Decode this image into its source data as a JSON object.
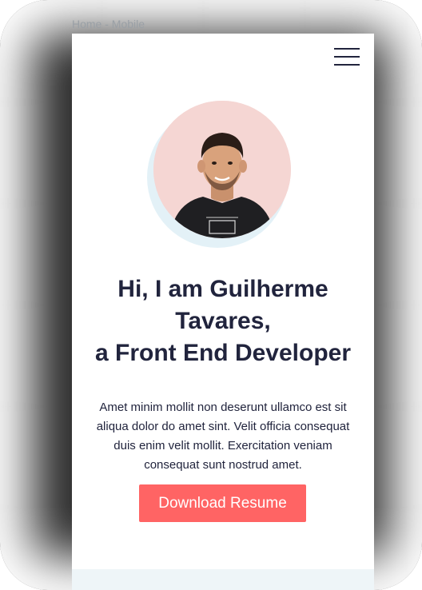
{
  "frame": {
    "title": "Home - Mobile"
  },
  "hero": {
    "headline_line1": "Hi, I am Guilherme",
    "headline_line2": "Tavares,",
    "headline_line3": "a Front End Developer",
    "intro": "Amet minim mollit non deserunt ullamco est sit aliqua dolor do amet sint. Velit officia consequat duis enim velit mollit. Exercitation veniam consequat sunt nostrud amet.",
    "cta_label": "Download Resume"
  },
  "colors": {
    "accent": "#ff6464",
    "text": "#21243d",
    "avatar_ring": "#e3f1f7"
  },
  "icons": {
    "menu": "hamburger-menu-icon"
  }
}
